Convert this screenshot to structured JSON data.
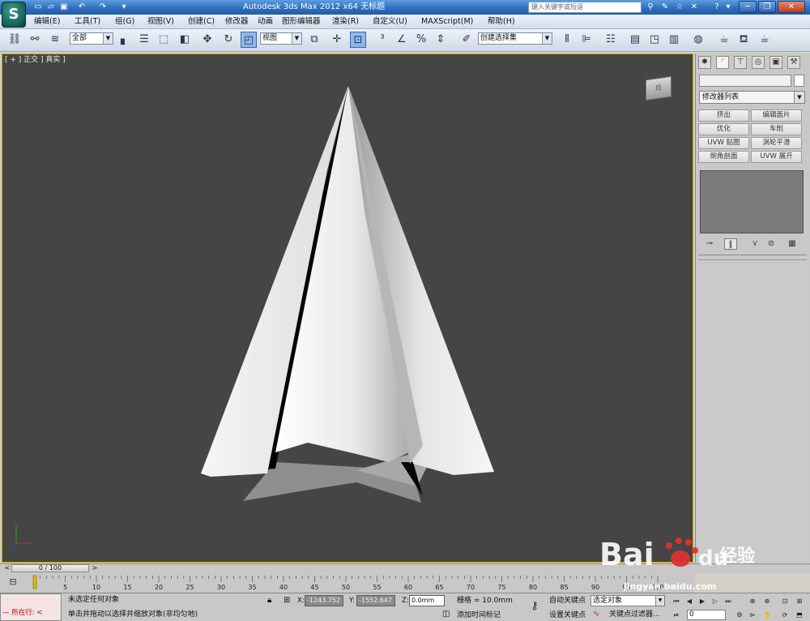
{
  "titlebar": {
    "title": "Autodesk 3ds Max  2012 x64       无标题",
    "search_placeholder": "键入关键字或短语",
    "win_minimize": "─",
    "win_restore": "❐",
    "win_close": "✕"
  },
  "menu": [
    "编辑(E)",
    "工具(T)",
    "组(G)",
    "视图(V)",
    "创建(C)",
    "修改器",
    "动画",
    "图形编辑器",
    "渲染(R)",
    "自定义(U)",
    "MAXScript(M)",
    "帮助(H)"
  ],
  "toolbar": {
    "selection_filter": "全部",
    "ref_coord": "视图",
    "named_selection": "创建选择集"
  },
  "viewport": {
    "label": "[ + ] 正交 ] 真实 ]",
    "viewcube_text": "后"
  },
  "command_panel": {
    "modifier_list": "修改器列表",
    "modifier_buttons": [
      "挤出",
      "编辑面片",
      "优化",
      "车削",
      "UVW 贴图",
      "涡轮平滑",
      "倒角剖面",
      "UVW 展开"
    ]
  },
  "timeslider": {
    "position": "0 / 100",
    "current_frame": 0,
    "total_frames": 100,
    "ticks": [
      "0",
      "5",
      "10",
      "15",
      "20",
      "25",
      "30",
      "35",
      "40",
      "45",
      "50",
      "55",
      "60",
      "65",
      "70",
      "75",
      "80",
      "85",
      "90",
      "95",
      "100"
    ]
  },
  "status": {
    "maxscript": "— 所在行:  <",
    "line1": "未选定任何对象",
    "line2": "单击并拖动以选择并缩放对象(非均匀地)",
    "x_value": "-1243.752",
    "y_value": "-1552.647",
    "z_value": "0.0mm",
    "x_label": "X:",
    "y_label": "Y:",
    "z_label": "Z:",
    "grid": "栅格 = 10.0mm",
    "add_time_tag": "添加时间标记",
    "auto_key": "自动关键点",
    "set_key": "设置关键点",
    "selection_set": "选定对象",
    "key_filters": "关键点过滤器...",
    "frame": "0"
  },
  "watermark": {
    "url": "jingyan.baidu.com",
    "brand": "Bai",
    "brand2": "du",
    "brand3": "经验"
  },
  "colors": {
    "viewport_bg": "#454545",
    "viewport_border": "#c9a400",
    "titlebar": "#2f6fbf",
    "mesh_light": "#f2f2f2",
    "mesh_shadow": "#050505"
  }
}
